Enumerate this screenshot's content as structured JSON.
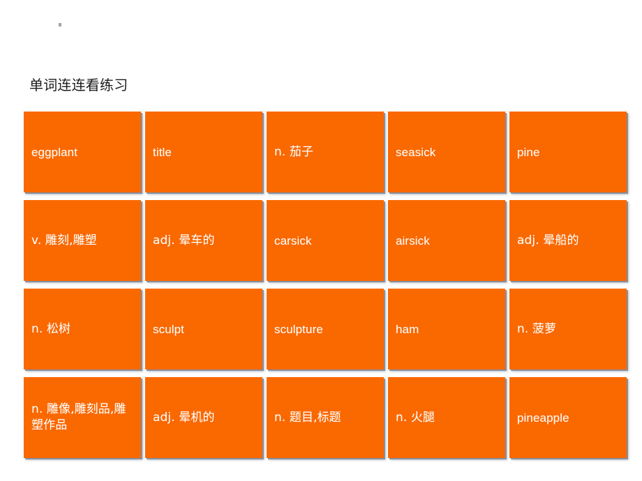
{
  "slide": {
    "background_color": "#ffffff",
    "title": "单词连连看练习",
    "corner_mark": "."
  },
  "theme": {
    "card_color": "#fa6800",
    "card_text_color": "#ffffff",
    "title_color": "#1a1a1a",
    "shadow_color": "#7d8696"
  },
  "grid": {
    "columns": 5,
    "rows": 4,
    "cards": [
      {
        "id": "card-1",
        "row": 1,
        "col": 1,
        "text": "eggplant"
      },
      {
        "id": "card-2",
        "row": 1,
        "col": 2,
        "text": "title"
      },
      {
        "id": "card-3",
        "row": 1,
        "col": 3,
        "text": "n. 茄子"
      },
      {
        "id": "card-4",
        "row": 1,
        "col": 4,
        "text": "seasick"
      },
      {
        "id": "card-5",
        "row": 1,
        "col": 5,
        "text": "pine"
      },
      {
        "id": "card-6",
        "row": 2,
        "col": 1,
        "text": "v. 雕刻,雕塑"
      },
      {
        "id": "card-7",
        "row": 2,
        "col": 2,
        "text": "adj. 晕车的"
      },
      {
        "id": "card-8",
        "row": 2,
        "col": 3,
        "text": "carsick"
      },
      {
        "id": "card-9",
        "row": 2,
        "col": 4,
        "text": "airsick"
      },
      {
        "id": "card-10",
        "row": 2,
        "col": 5,
        "text": "adj. 晕船的"
      },
      {
        "id": "card-11",
        "row": 3,
        "col": 1,
        "text": "n. 松树"
      },
      {
        "id": "card-12",
        "row": 3,
        "col": 2,
        "text": "sculpt"
      },
      {
        "id": "card-13",
        "row": 3,
        "col": 3,
        "text": "sculpture"
      },
      {
        "id": "card-14",
        "row": 3,
        "col": 4,
        "text": "ham"
      },
      {
        "id": "card-15",
        "row": 3,
        "col": 5,
        "text": "n. 菠萝"
      },
      {
        "id": "card-16",
        "row": 4,
        "col": 1,
        "text": "n. 雕像,雕刻品,雕塑作品"
      },
      {
        "id": "card-17",
        "row": 4,
        "col": 2,
        "text": "adj. 晕机的"
      },
      {
        "id": "card-18",
        "row": 4,
        "col": 3,
        "text": "n. 题目,标题"
      },
      {
        "id": "card-19",
        "row": 4,
        "col": 4,
        "text": "n. 火腿"
      },
      {
        "id": "card-20",
        "row": 4,
        "col": 5,
        "text": "pineapple"
      }
    ]
  }
}
